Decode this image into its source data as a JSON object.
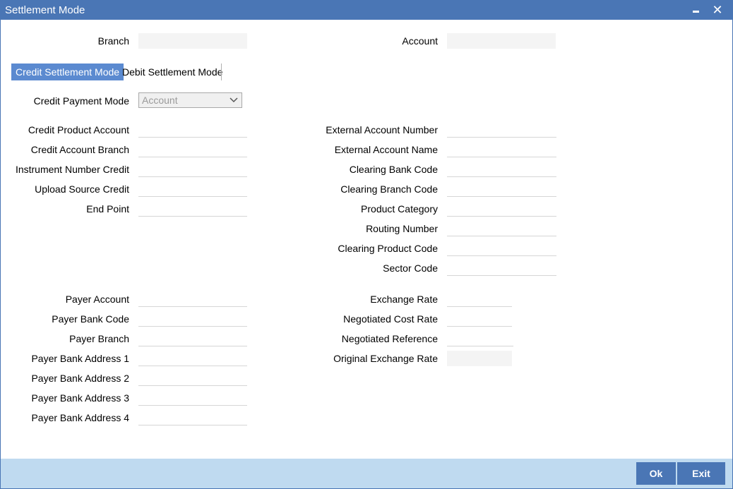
{
  "window": {
    "title": "Settlement Mode"
  },
  "header": {
    "branch_label": "Branch",
    "branch_value": "",
    "account_label": "Account",
    "account_value": ""
  },
  "tabs": [
    {
      "label": "Credit Settlement Mode",
      "active": true
    },
    {
      "label": "Debit Settlement Mode",
      "active": false
    }
  ],
  "credit": {
    "payment_mode_label": "Credit Payment Mode",
    "payment_mode_value": "Account",
    "left_fields": [
      {
        "label": "Credit Product Account",
        "value": ""
      },
      {
        "label": "Credit Account Branch",
        "value": ""
      },
      {
        "label": "Instrument Number Credit",
        "value": ""
      },
      {
        "label": "Upload Source Credit",
        "value": ""
      },
      {
        "label": "End Point",
        "value": ""
      }
    ],
    "right_fields": [
      {
        "label": "External Account Number",
        "value": ""
      },
      {
        "label": "External Account Name",
        "value": ""
      },
      {
        "label": "Clearing Bank Code",
        "value": ""
      },
      {
        "label": "Clearing Branch Code",
        "value": ""
      },
      {
        "label": "Product Category",
        "value": ""
      },
      {
        "label": "Routing Number",
        "value": ""
      },
      {
        "label": "Clearing Product Code",
        "value": ""
      },
      {
        "label": "Sector Code",
        "value": ""
      }
    ],
    "payer_fields": [
      {
        "label": "Payer Account",
        "value": ""
      },
      {
        "label": "Payer Bank Code",
        "value": ""
      },
      {
        "label": "Payer Branch",
        "value": ""
      },
      {
        "label": "Payer Bank Address 1",
        "value": ""
      },
      {
        "label": "Payer Bank Address 2",
        "value": ""
      },
      {
        "label": "Payer Bank Address 3",
        "value": ""
      },
      {
        "label": "Payer Bank Address 4",
        "value": ""
      }
    ],
    "rate_fields": [
      {
        "label": "Exchange Rate",
        "value": ""
      },
      {
        "label": "Negotiated Cost Rate",
        "value": ""
      },
      {
        "label": "Negotiated Reference",
        "value": ""
      },
      {
        "label": "Original Exchange Rate",
        "value": ""
      }
    ]
  },
  "footer": {
    "ok_label": "Ok",
    "exit_label": "Exit"
  },
  "colors": {
    "titlebar": "#4a76b5",
    "active_tab": "#5b8ad0",
    "footer": "#bfdaf0",
    "button": "#4a76b5"
  }
}
